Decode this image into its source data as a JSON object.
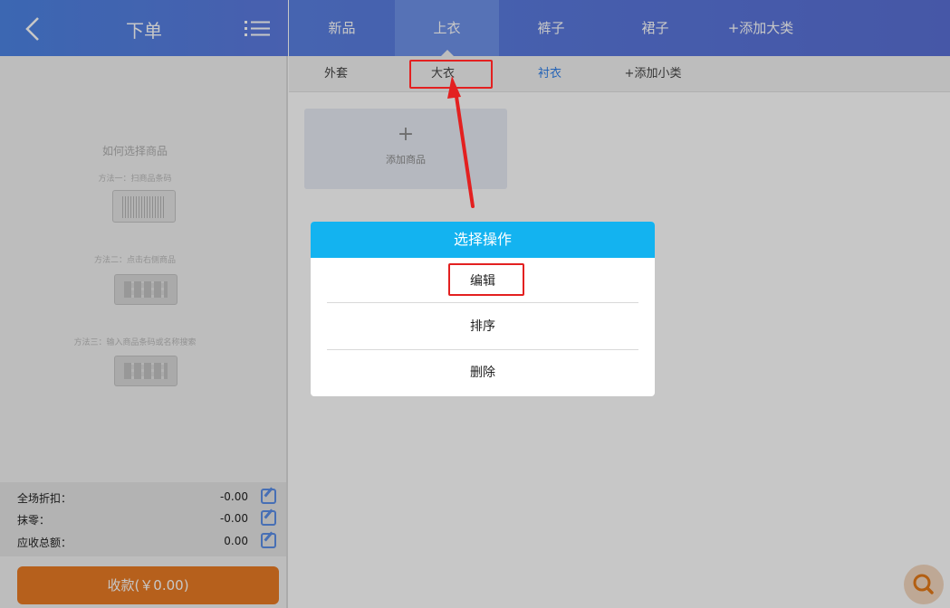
{
  "header": {
    "back_icon": "chevron-left-icon",
    "title": "下单",
    "menu_icon": "list-icon"
  },
  "help": {
    "title": "如何选择商品",
    "method1": "方法一：扫商品条码",
    "method2": "方法二：点击右侧商品",
    "method3": "方法三：输入商品条码或名称搜索"
  },
  "summary": {
    "discount_label": "全场折扣：",
    "discount_value": "-0.00",
    "round_label": "抹零：",
    "round_value": "-0.00",
    "total_label": "应收总额：",
    "total_value": "0.00"
  },
  "pay_button": "收款(￥0.00)",
  "top_tabs": [
    "新品",
    "上衣",
    "裤子",
    "裙子",
    "+添加大类"
  ],
  "top_tabs_active": "上衣",
  "sub_tabs": [
    "外套",
    "大衣",
    "衬衣",
    "+添加小类"
  ],
  "sub_tabs_active": "衬衣",
  "add_product": {
    "plus": "+",
    "label": "添加商品"
  },
  "dialog": {
    "title": "选择操作",
    "options": [
      "编辑",
      "排序",
      "删除"
    ]
  },
  "colors": {
    "header_blue": "#5a80e2",
    "dialog_blue": "#13b3f0",
    "pay_orange": "#ea7c25",
    "active_sub": "#2f7fe9",
    "annotation_red": "#e32020"
  }
}
